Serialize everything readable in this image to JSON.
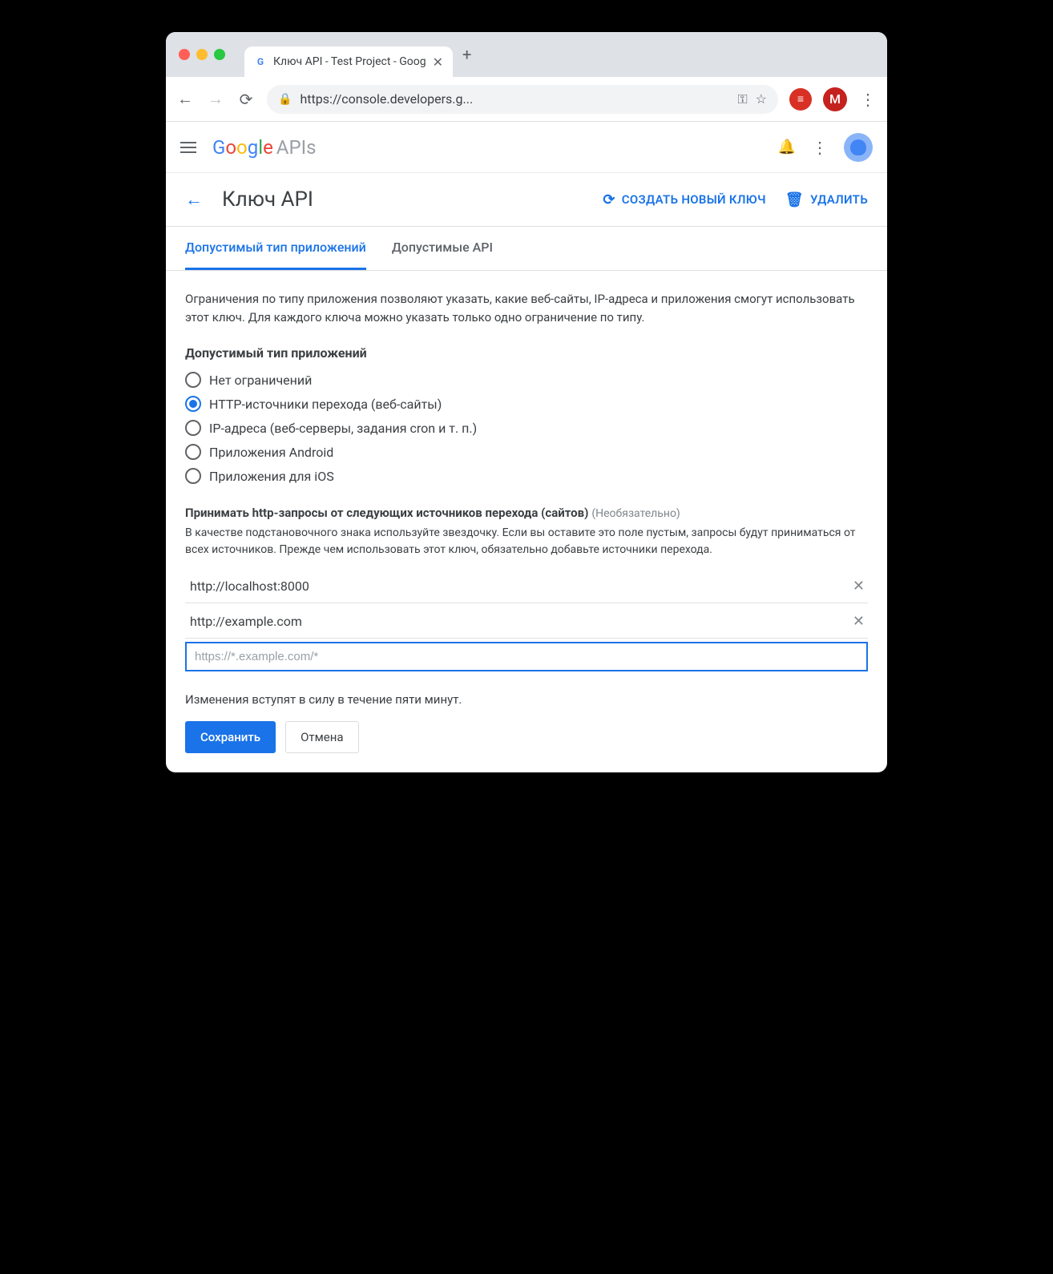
{
  "browser": {
    "tab_title": "Ключ API - Test Project - Goog",
    "url": "https://console.developers.g...",
    "avatar_letter": "M"
  },
  "header": {
    "logo_google": "Google",
    "logo_apis": "APIs"
  },
  "page": {
    "title": "Ключ API",
    "create_label": "СОЗДАТЬ НОВЫЙ КЛЮЧ",
    "delete_label": "УДАЛИТЬ"
  },
  "tabs": {
    "apps": "Допустимый тип приложений",
    "apis": "Допустимые API"
  },
  "body": {
    "description": "Ограничения по типу приложения позволяют указать, какие веб-сайты, IP-адреса и приложения смогут использовать этот ключ. Для каждого ключа можно указать только одно ограничение по типу.",
    "section_title": "Допустимый тип приложений",
    "radios": [
      "Нет ограничений",
      "HTTP-источники перехода (веб-сайты)",
      "IP-адреса (веб-серверы, задания cron и т. п.)",
      "Приложения Android",
      "Приложения для iOS"
    ],
    "selected_radio_index": 1,
    "referrers_title": "Принимать http-запросы от следующих источников перехода (сайтов)",
    "optional_label": "(Необязательно)",
    "referrers_desc": "В качестве подстановочного знака используйте звездочку. Если вы оставите это поле пустым, запросы будут приниматься от всех источников. Прежде чем использовать этот ключ, обязательно добавьте источники перехода.",
    "referrers": [
      "http://localhost:8000",
      "http://example.com"
    ],
    "referrer_placeholder": "https://*.example.com/*",
    "notice": "Изменения вступят в силу в течение пяти минут.",
    "save_label": "Сохранить",
    "cancel_label": "Отмена"
  }
}
